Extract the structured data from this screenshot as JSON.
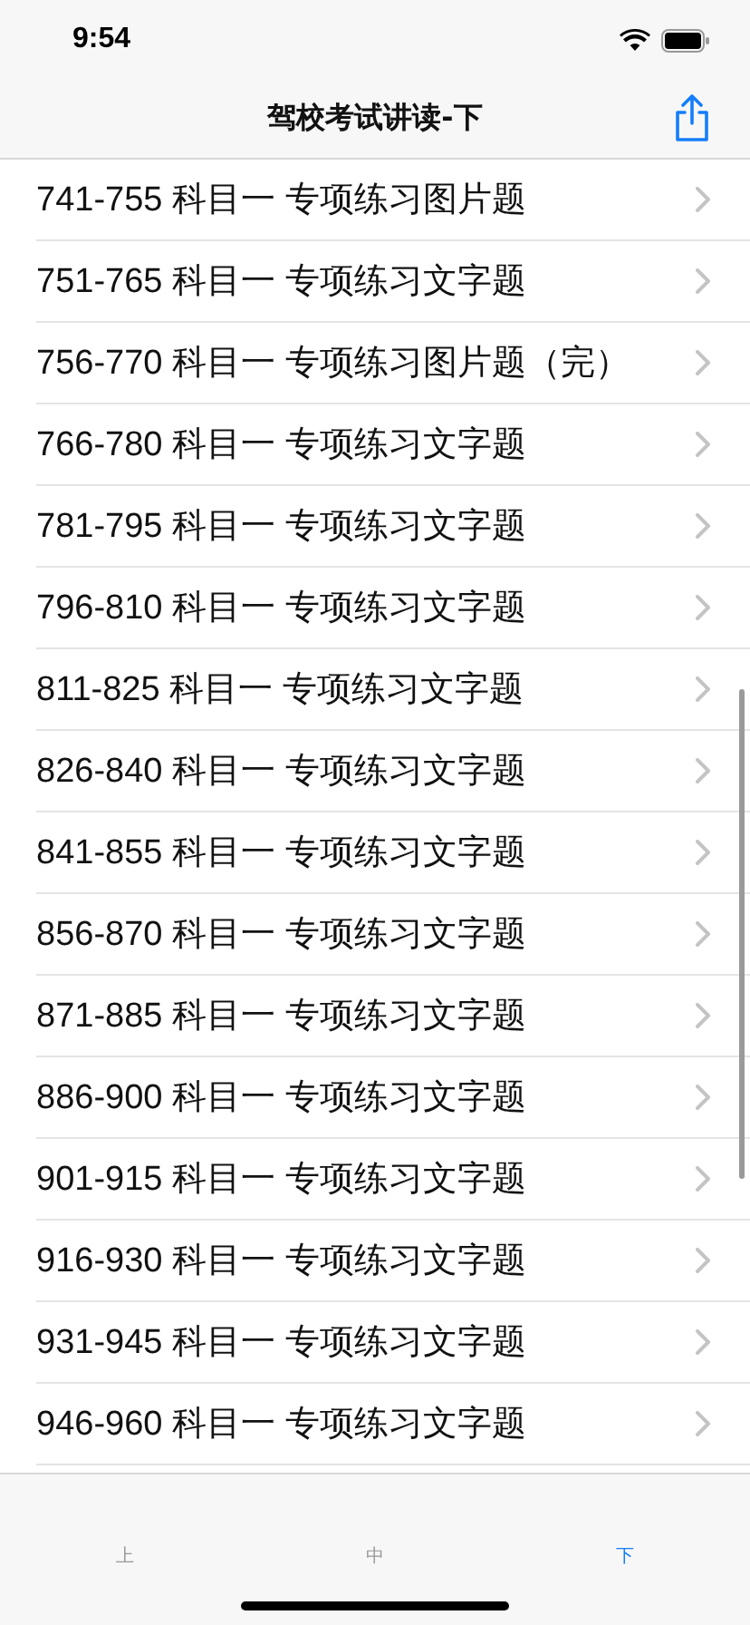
{
  "status_bar": {
    "time": "9:54"
  },
  "nav_bar": {
    "title": "驾校考试讲读-下"
  },
  "list": [
    {
      "label": "741-755 科目一 专项练习图片题"
    },
    {
      "label": "751-765 科目一 专项练习文字题"
    },
    {
      "label": "756-770 科目一 专项练习图片题（完）"
    },
    {
      "label": "766-780 科目一 专项练习文字题"
    },
    {
      "label": "781-795 科目一 专项练习文字题"
    },
    {
      "label": "796-810 科目一 专项练习文字题"
    },
    {
      "label": "811-825 科目一 专项练习文字题"
    },
    {
      "label": "826-840 科目一 专项练习文字题"
    },
    {
      "label": "841-855 科目一 专项练习文字题"
    },
    {
      "label": "856-870 科目一 专项练习文字题"
    },
    {
      "label": "871-885 科目一 专项练习文字题"
    },
    {
      "label": "886-900 科目一 专项练习文字题"
    },
    {
      "label": "901-915 科目一 专项练习文字题"
    },
    {
      "label": "916-930 科目一 专项练习文字题"
    },
    {
      "label": "931-945 科目一 专项练习文字题"
    },
    {
      "label": "946-960 科目一 专项练习文字题"
    }
  ],
  "tabs": [
    {
      "label": "上",
      "selected": false
    },
    {
      "label": "中",
      "selected": false
    },
    {
      "label": "下",
      "selected": true
    }
  ]
}
